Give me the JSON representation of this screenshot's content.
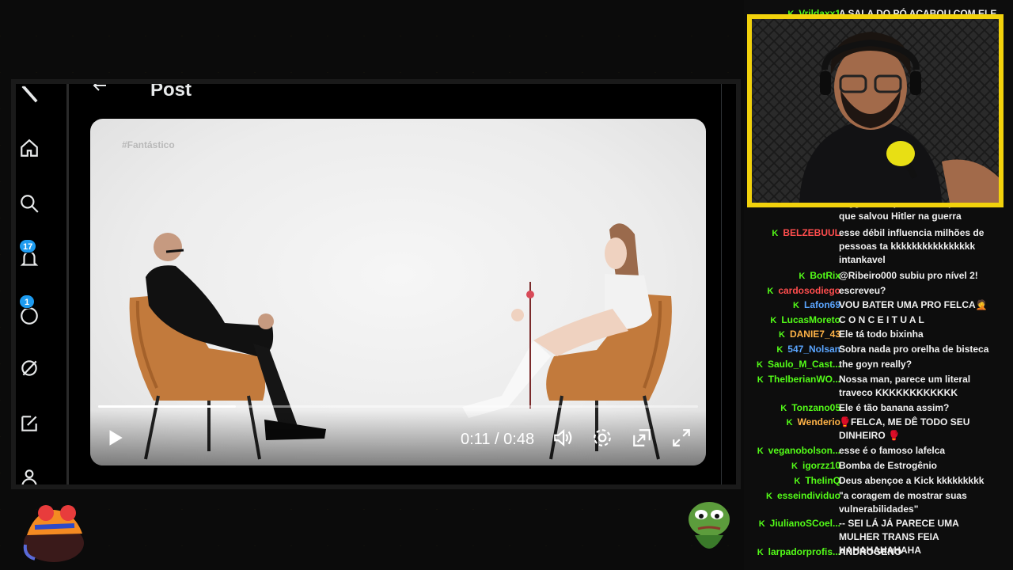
{
  "x_app": {
    "page_title": "Post",
    "nav_badges": {
      "notifications": "17",
      "messages": "1"
    },
    "nav_icons": [
      "x-logo-icon",
      "home-icon",
      "search-icon",
      "notifications-icon",
      "messages-icon",
      "grok-icon",
      "compose-icon",
      "profile-icon"
    ]
  },
  "video": {
    "watermark": "#Fantástico",
    "current_time": "0:11",
    "separator": "/",
    "duration": "0:48",
    "progress_fraction": 0.23
  },
  "chat": {
    "badge_glyph": "K",
    "messages": [
      {
        "user": "Vrildaxx1",
        "color": "#53fc18",
        "text": "A SALA DO PÓ ACABOU COM ELE 🥊"
      },
      {
        "user": "",
        "color": "#53fc18",
        "text": "Digga: eh equivalente aquele cara que salvou Hitler na guerra"
      },
      {
        "user": "BELZEBUUL",
        "color": "#ff4d4d",
        "text": "esse débil influencia milhões de pessoas ta kkkkkkkkkkkkkkkk intankavel"
      },
      {
        "user": "BotRix",
        "color": "#53fc18",
        "text": "@Ribeiro000 subiu pro nível 2!"
      },
      {
        "user": "cardosodiego",
        "color": "#ff4d4d",
        "text": "escreveu?"
      },
      {
        "user": "Lafon69",
        "color": "#5aa5ff",
        "text": "VOU BATER UMA PRO FELCA🤦"
      },
      {
        "user": "LucasMoreto",
        "color": "#53fc18",
        "text": "C O N C E I T U A L"
      },
      {
        "user": "DANIE7_43",
        "color": "#ffb347",
        "text": "Ele tá todo bixinha"
      },
      {
        "user": "547_Nolsan",
        "color": "#5aa5ff",
        "text": "Sobra nada pro orelha de bisteca"
      },
      {
        "user": "Saulo_M_Cast...",
        "color": "#53fc18",
        "text": "the goyn really?"
      },
      {
        "user": "TheIberianWO...",
        "color": "#53fc18",
        "text": "Nossa man, parece um literal traveco KKKKKKKKKKKK"
      },
      {
        "user": "Tonzano05",
        "color": "#53fc18",
        "text": "Ele é tão banana assim?"
      },
      {
        "user": "Wenderio",
        "color": "#ffb347",
        "text": "🥊FELCA, ME DÊ TODO SEU DINHEIRO 🥊"
      },
      {
        "user": "veganobolson...",
        "color": "#53fc18",
        "text": "esse é o famoso lafelca"
      },
      {
        "user": "igorzz10",
        "color": "#53fc18",
        "text": "Bomba de Estrogênio"
      },
      {
        "user": "TheIinQ",
        "color": "#53fc18",
        "text": "Deus abençoe a Kick kkkkkkkkk"
      },
      {
        "user": "esseindividuo",
        "color": "#53fc18",
        "text": "\"a coragem de mostrar suas vulnerabilidades\""
      },
      {
        "user": "JiulianoSCoel...",
        "color": "#53fc18",
        "text": "-- SEI LÁ JÁ PARECE UMA MULHER TRANS FEIA HAHAHAHAHAHA"
      },
      {
        "user": "larpadorprofis...",
        "color": "#53fc18",
        "text": "ANDROGENO"
      }
    ]
  },
  "colors": {
    "cam_border": "#f2d20c",
    "kick_green": "#53fc18",
    "x_blue": "#1d9bf0"
  }
}
